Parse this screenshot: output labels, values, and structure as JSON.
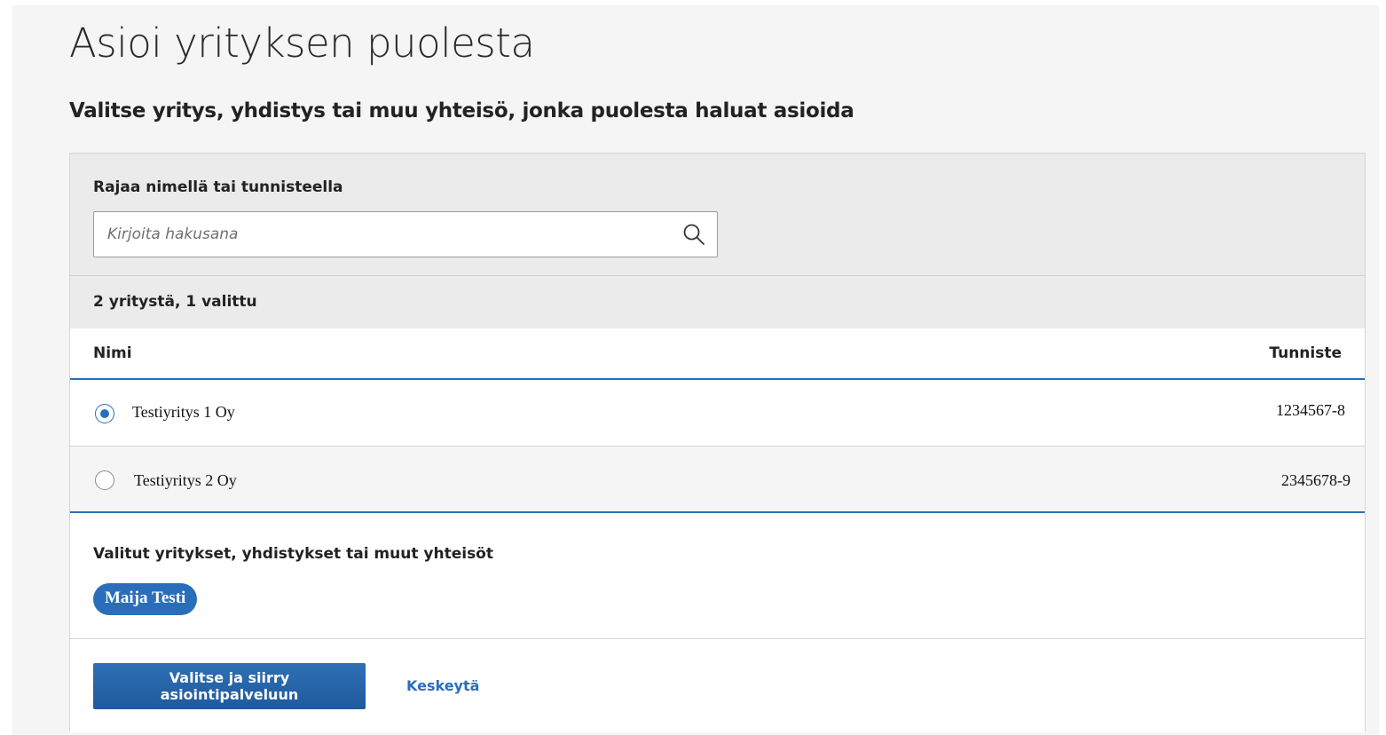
{
  "page": {
    "title": "Asioi yrityksen puolesta",
    "subtitle": "Valitse yritys, yhdistys tai muu yhteisö, jonka puolesta haluat asioida"
  },
  "filter": {
    "label": "Rajaa nimellä tai tunnisteella",
    "placeholder": "Kirjoita hakusana",
    "value": "",
    "icon": "search-icon"
  },
  "results": {
    "count_text": "2 yritystä, 1 valittu"
  },
  "table": {
    "columns": [
      "Nimi",
      "Tunniste"
    ],
    "rows": [
      {
        "name": "Testiyritys 1 Oy",
        "id": "1234567-8",
        "selected": true
      },
      {
        "name": "Testiyritys 2 Oy",
        "id": "2345678-9",
        "selected": false
      }
    ]
  },
  "selected": {
    "label": "Valitut yritykset, yhdistykset tai muut yhteisöt",
    "chips": [
      "Maija Testi"
    ]
  },
  "actions": {
    "primary_label": "Valitse ja siirry asiointipalveluun",
    "cancel_label": "Keskeytä"
  },
  "colors": {
    "accent": "#2a6ebb",
    "panel_gray": "#ebebeb",
    "page_bg": "#f5f5f5"
  }
}
